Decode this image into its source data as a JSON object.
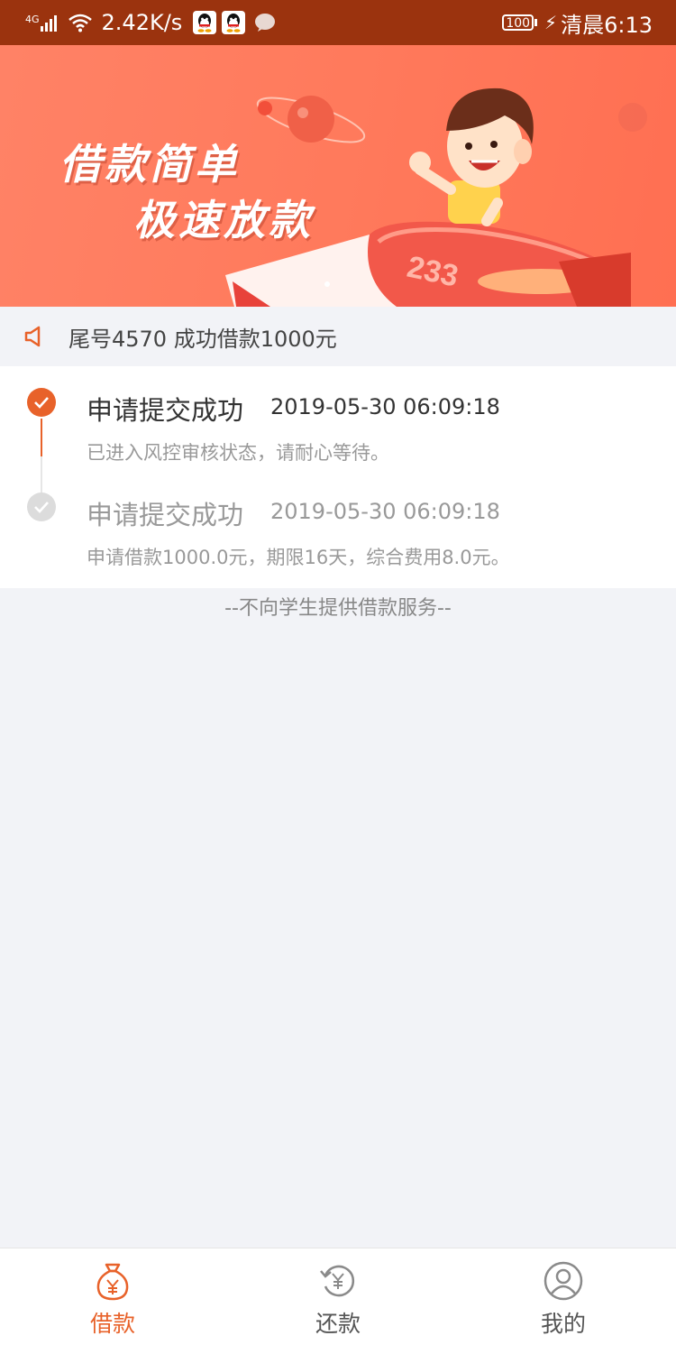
{
  "status_bar": {
    "network": "4G",
    "speed": "2.42K/s",
    "battery": "100",
    "time": "清晨6:13"
  },
  "banner": {
    "line1": "借款简单",
    "line2": "极速放款",
    "plane_number": "233"
  },
  "notice": {
    "text": "尾号4570 成功借款1000元",
    "icon": "speaker-icon"
  },
  "timeline": [
    {
      "title": "申请提交成功",
      "time": "2019-05-30 06:09:18",
      "desc": "已进入风控审核状态，请耐心等待。",
      "active": true
    },
    {
      "title": "申请提交成功",
      "time": "2019-05-30 06:09:18",
      "desc": "申请借款1000.0元，期限16天，综合费用8.0元。",
      "active": false
    }
  ],
  "footer_note": "--不向学生提供借款服务--",
  "tabs": [
    {
      "label": "借款",
      "icon": "money-bag-icon",
      "active": true
    },
    {
      "label": "还款",
      "icon": "repay-icon",
      "active": false
    },
    {
      "label": "我的",
      "icon": "profile-icon",
      "active": false
    }
  ],
  "colors": {
    "accent": "#e8622a",
    "status_bar": "#9b330e",
    "inactive": "#888888"
  }
}
